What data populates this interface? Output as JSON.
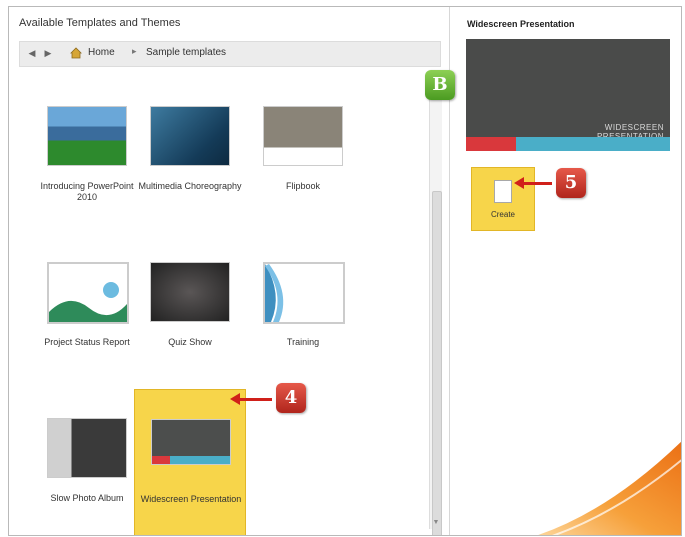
{
  "left_panel": {
    "title": "Available Templates and Themes",
    "nav": {
      "back_icon": "back-arrow-icon",
      "forward_icon": "forward-arrow-icon",
      "home_label": "Home",
      "current": "Sample templates"
    },
    "templates": [
      {
        "label": "Introducing PowerPoint 2010",
        "icon": "template-thumbnail"
      },
      {
        "label": "Multimedia Choreography",
        "icon": "template-thumbnail"
      },
      {
        "label": "Flipbook",
        "icon": "template-thumbnail"
      },
      {
        "label": "Project Status Report",
        "icon": "template-thumbnail"
      },
      {
        "label": "Quiz Show",
        "icon": "template-thumbnail"
      },
      {
        "label": "Training",
        "icon": "template-thumbnail"
      },
      {
        "label": "Slow Photo Album",
        "icon": "template-thumbnail"
      },
      {
        "label": "Widescreen Presentation",
        "icon": "template-thumbnail",
        "selected": true
      }
    ]
  },
  "right_panel": {
    "title": "Widescreen Presentation",
    "preview_text": "WIDESCREEN PRESENTATION",
    "create_label": "Create"
  },
  "callouts": {
    "b": "B",
    "four": "4",
    "five": "5"
  },
  "colors": {
    "selection": "#f7d54a",
    "callout_red": "#d0201a",
    "callout_green": "#5aa82d",
    "accent_orange": "#f07f12"
  }
}
